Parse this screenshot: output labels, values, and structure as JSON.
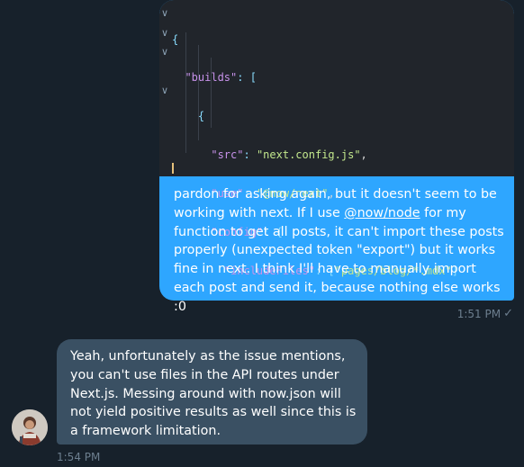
{
  "outgoing": {
    "code_lines": [
      "{",
      "  \"builds\": [",
      "    {",
      "      \"src\": \"next.config.js\",",
      "      \"use\": \"@now/next\",",
      "      \"config\": {",
      "        \"includeFiles\": [\"pages/blog/*.mdx\"]",
      "      }",
      "    }",
      "  ]",
      "}"
    ],
    "text_before_mention": "pardon for asking again, but it doesn't seem to be working with next. If I use ",
    "mention": "@now/node",
    "text_after_mention": " for my function to get all posts, it can't import these posts properly (unexpected token \"export\") but it works fine in next. I think I'll have to manually import each post and send it, because nothing else works :0",
    "time": "1:51 PM",
    "status_icon": "check-icon"
  },
  "incoming": {
    "text": "Yeah, unfortunately as the issue mentions, you can't use files in the API routes under Next.js. Messing around with now.json will not yield positive results as well since this is a framework limitation.",
    "time": "1:54 PM",
    "avatar_icon": "user-avatar"
  },
  "colors": {
    "background": "#17212b",
    "outgoing_bubble": "#2ea6ff",
    "incoming_bubble": "#3a5063",
    "meta_text": "#6d7f8f"
  }
}
